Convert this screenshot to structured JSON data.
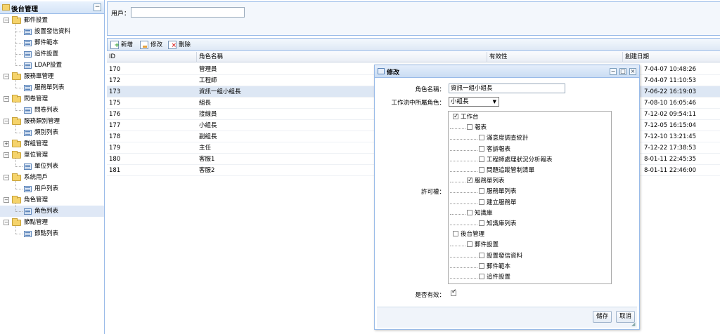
{
  "sidebar": {
    "title": "後台管理",
    "collapse_glyph": "−",
    "groups": [
      {
        "label": "郵件設置",
        "children": [
          "設置發信資料",
          "郵件範本",
          "追件設置",
          "LDAP設置"
        ]
      },
      {
        "label": "服務單管理",
        "children": [
          "服務單列表"
        ]
      },
      {
        "label": "問卷管理",
        "children": [
          "問卷列表"
        ]
      },
      {
        "label": "服務類別管理",
        "children": [
          "類別列表"
        ]
      },
      {
        "label": "群組管理",
        "children": [],
        "collapsed": true
      },
      {
        "label": "單位管理",
        "children": [
          "單位列表"
        ]
      },
      {
        "label": "系統用戶",
        "children": [
          "用戶列表"
        ]
      },
      {
        "label": "角色管理",
        "children": [
          "角色列表"
        ]
      },
      {
        "label": "節點管理",
        "children": [
          "節點列表"
        ]
      }
    ],
    "selected": "角色列表"
  },
  "search": {
    "user_label": "用戶：",
    "user_value": ""
  },
  "toolbar": {
    "add_label": "新增",
    "edit_label": "修改",
    "delete_label": "刪除"
  },
  "grid": {
    "columns": [
      "ID",
      "角色名稱",
      "有效性",
      "創建日期"
    ],
    "rows": [
      {
        "id": "170",
        "name": "管理員",
        "valid": "",
        "date": "7-04-07 10:48:26"
      },
      {
        "id": "172",
        "name": "工程師",
        "valid": "",
        "date": "7-04-07 11:10:53"
      },
      {
        "id": "173",
        "name": "資訊一組小組長",
        "valid": "",
        "date": "7-06-22 16:19:03",
        "selected": true
      },
      {
        "id": "175",
        "name": "組長",
        "valid": "",
        "date": "7-08-10 16:05:46"
      },
      {
        "id": "176",
        "name": "接線員",
        "valid": "",
        "date": "7-12-02 09:54:11"
      },
      {
        "id": "177",
        "name": "小組長",
        "valid": "",
        "date": "7-12-05 16:15:04"
      },
      {
        "id": "178",
        "name": "副組長",
        "valid": "",
        "date": "7-12-10 13:21:45"
      },
      {
        "id": "179",
        "name": "主任",
        "valid": "",
        "date": "7-12-22 17:38:53"
      },
      {
        "id": "180",
        "name": "客服1",
        "valid": "",
        "date": "8-01-11 22:45:35"
      },
      {
        "id": "181",
        "name": "客服2",
        "valid": "",
        "date": "8-01-11 22:46:00"
      }
    ]
  },
  "dialog": {
    "title": "修改",
    "window_buttons": [
      "−",
      "□",
      "×"
    ],
    "role_name_label": "角色名稱：",
    "role_name_value": "資訊一組小組長",
    "workflow_label": "工作流中所屬角色：",
    "workflow_value": "小組長",
    "perm_label": "許可權：",
    "valid_label": "是否有效：",
    "valid_checked": true,
    "permissions": [
      {
        "label": "工作台",
        "level": 0,
        "checked": true
      },
      {
        "label": "報表",
        "level": 1,
        "checked": false
      },
      {
        "label": "滿意度調查統計",
        "level": 2,
        "checked": false
      },
      {
        "label": "客訴報表",
        "level": 2,
        "checked": false
      },
      {
        "label": "工程師處理狀況分析報表",
        "level": 2,
        "checked": false
      },
      {
        "label": "問題追蹤管制清單",
        "level": 2,
        "checked": false
      },
      {
        "label": "服務單列表",
        "level": 1,
        "checked": true
      },
      {
        "label": "服務單列表",
        "level": 2,
        "checked": false
      },
      {
        "label": "建立服務單",
        "level": 2,
        "checked": false
      },
      {
        "label": "知識庫",
        "level": 1,
        "checked": false
      },
      {
        "label": "知識庫列表",
        "level": 2,
        "checked": false
      },
      {
        "label": "後台管理",
        "level": 0,
        "checked": false
      },
      {
        "label": "郵件設置",
        "level": 1,
        "checked": false
      },
      {
        "label": "設置發信資料",
        "level": 2,
        "checked": false
      },
      {
        "label": "郵件範本",
        "level": 2,
        "checked": false
      },
      {
        "label": "追件設置",
        "level": 2,
        "checked": false
      }
    ],
    "save_label": "儲存",
    "cancel_label": "取消"
  }
}
